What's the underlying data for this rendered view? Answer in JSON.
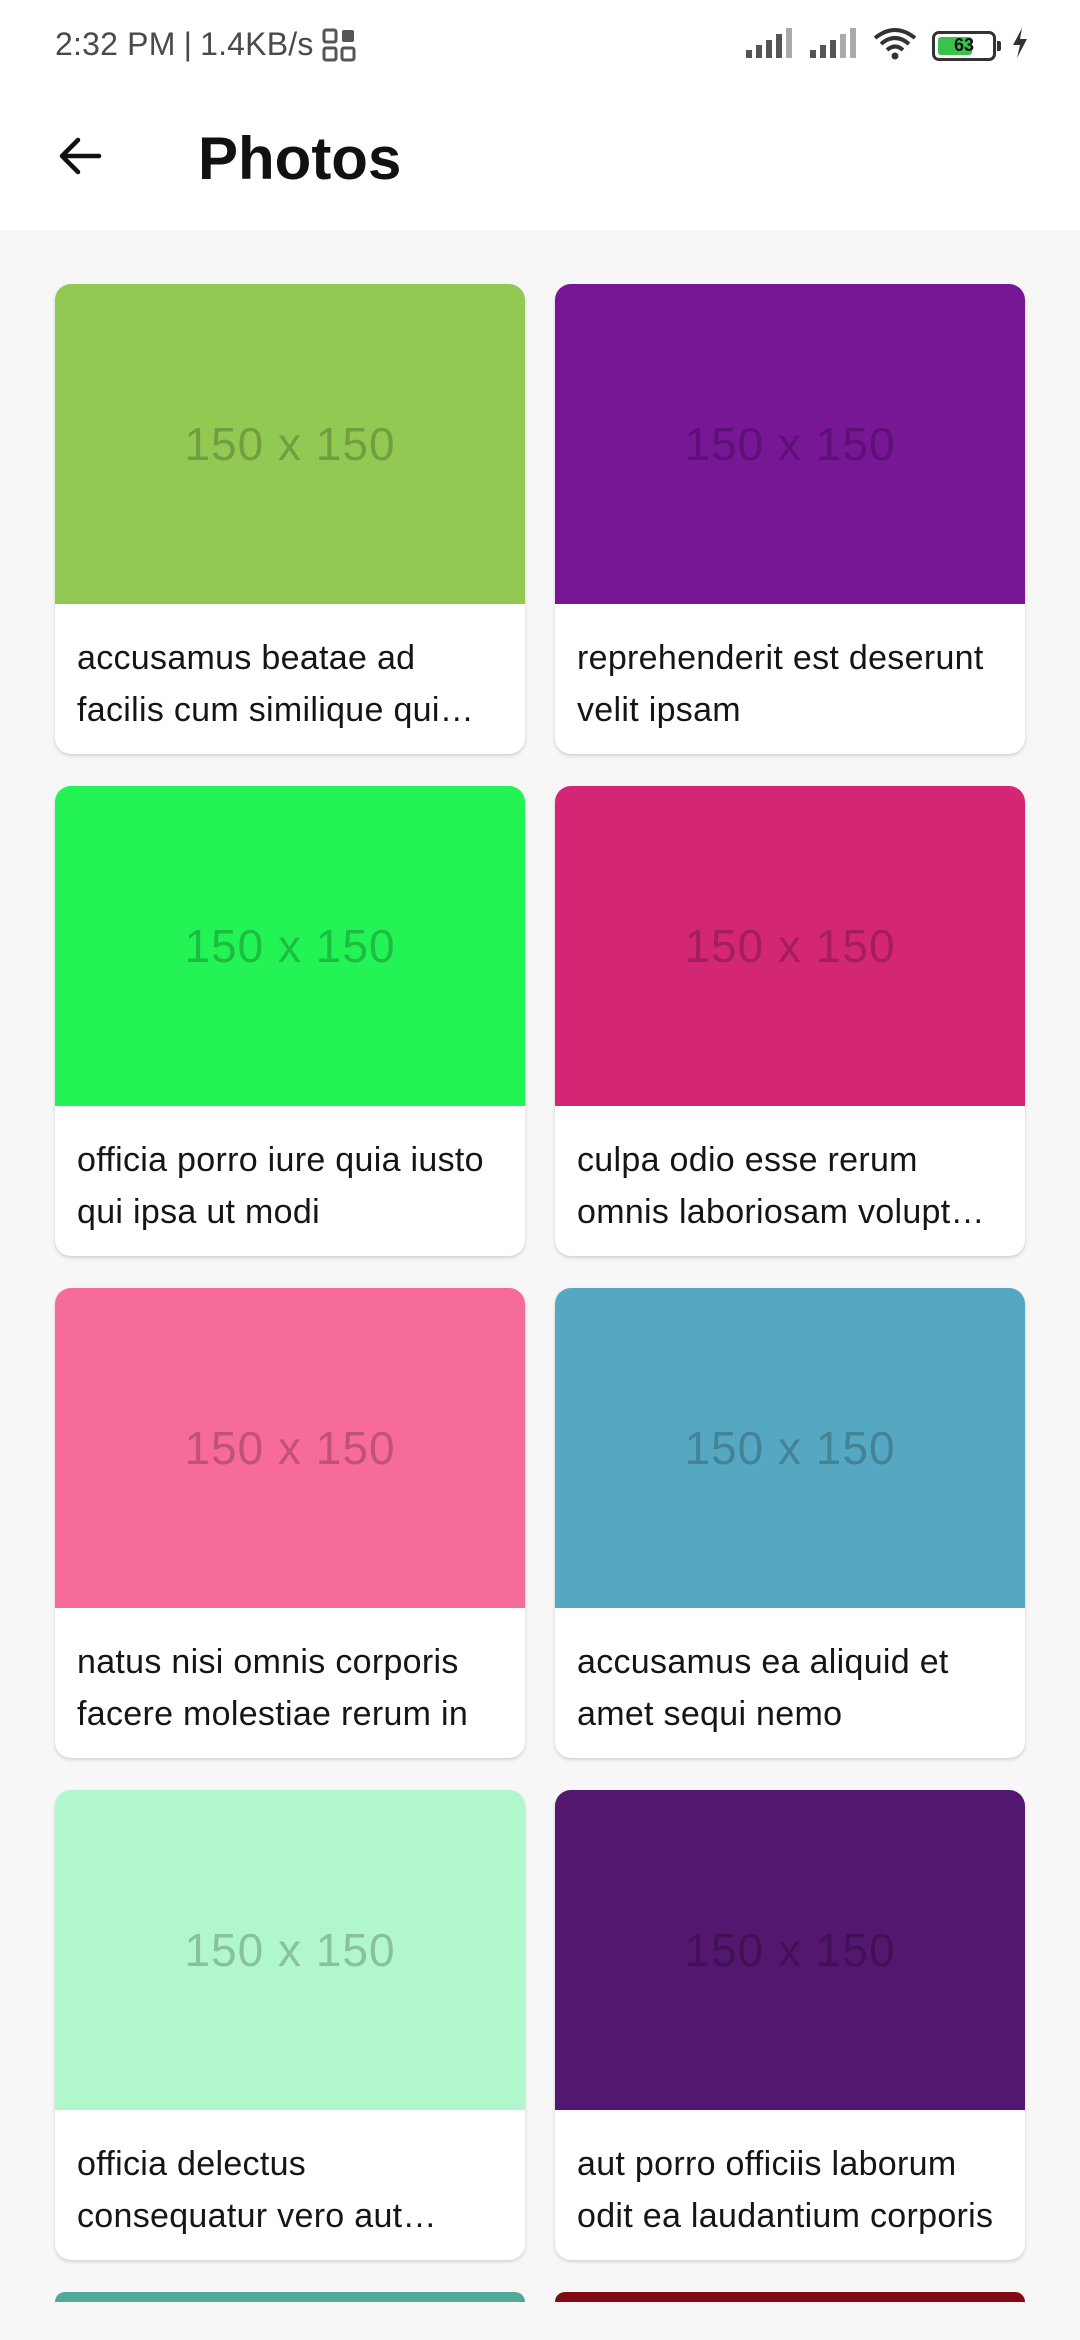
{
  "status_bar": {
    "time": "2:32 PM",
    "separator": "|",
    "network_speed": "1.4KB/s",
    "battery_level": "63",
    "battery_color": "#3cc24a"
  },
  "app_bar": {
    "back_icon": "arrow-left-icon",
    "title": "Photos"
  },
  "photos": [
    {
      "thumb_text": "150 x 150",
      "color": "#92c952",
      "title": "accusamus beatae ad facilis cum similique qui sunt"
    },
    {
      "thumb_text": "150 x 150",
      "color": "#771796",
      "title": "reprehenderit est deserunt velit ipsam"
    },
    {
      "thumb_text": "150 x 150",
      "color": "#24f355",
      "title": "officia porro iure quia iusto qui ipsa ut modi"
    },
    {
      "thumb_text": "150 x 150",
      "color": "#d32776",
      "title": "culpa odio esse rerum omnis laboriosam voluptate repudiandae"
    },
    {
      "thumb_text": "150 x 150",
      "color": "#f66b97",
      "title": "natus nisi omnis corporis facere molestiae rerum in"
    },
    {
      "thumb_text": "150 x 150",
      "color": "#56a8c2",
      "title": "accusamus ea aliquid et amet sequi nemo"
    },
    {
      "thumb_text": "150 x 150",
      "color": "#b0f7cc",
      "title": "officia delectus consequatur vero aut veniam explicabo molestias"
    },
    {
      "thumb_text": "150 x 150",
      "color": "#54176f",
      "title": "aut porro officiis laborum odit ea laudantium corporis"
    }
  ],
  "partial_rows": [
    {
      "color": "#51aa97"
    },
    {
      "color": "#810b14"
    }
  ]
}
